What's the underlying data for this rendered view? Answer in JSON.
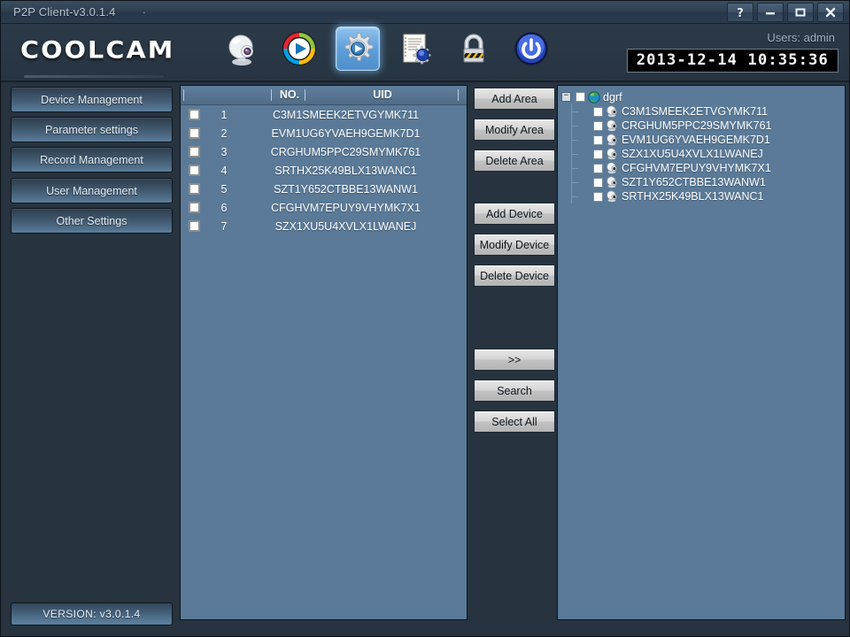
{
  "window": {
    "title": "P2P Client-v3.0.1.4",
    "buttons": [
      {
        "name": "help-button",
        "label": "?"
      },
      {
        "name": "minimize-button",
        "label": "–"
      },
      {
        "name": "maximize-button",
        "label": "□"
      },
      {
        "name": "close-button",
        "label": "✕"
      }
    ]
  },
  "header": {
    "logo": "COOLCAM",
    "user_label": "Users: admin",
    "datetime": "2013-12-14 10:35:36",
    "toolbar": [
      {
        "name": "camera-icon",
        "label": "Camera",
        "active": false
      },
      {
        "name": "playback-icon",
        "label": "Playback",
        "active": false
      },
      {
        "name": "settings-gear-icon",
        "label": "Settings",
        "active": true
      },
      {
        "name": "log-icon",
        "label": "Log",
        "active": false
      },
      {
        "name": "lock-icon",
        "label": "Lock",
        "active": false
      },
      {
        "name": "power-icon",
        "label": "Power",
        "active": false
      }
    ]
  },
  "sidebar": {
    "items": [
      {
        "label": "Device Management"
      },
      {
        "label": "Parameter settings"
      },
      {
        "label": "Record Management"
      },
      {
        "label": "User Management"
      },
      {
        "label": "Other Settings"
      }
    ],
    "version": "VERSION: v3.0.1.4"
  },
  "device_list": {
    "columns": [
      "NO.",
      "UID"
    ],
    "rows": [
      {
        "no": "1",
        "uid": "C3M1SMEEK2ETVGYMK711",
        "checked": false
      },
      {
        "no": "2",
        "uid": "EVM1UG6YVAEH9GEMK7D1",
        "checked": false
      },
      {
        "no": "3",
        "uid": "CRGHUM5PPC29SMYMK761",
        "checked": false
      },
      {
        "no": "4",
        "uid": "SRTHX25K49BLX13WANC1",
        "checked": false
      },
      {
        "no": "5",
        "uid": "SZT1Y652CTBBE13WANW1",
        "checked": false
      },
      {
        "no": "6",
        "uid": "CFGHVM7EPUY9VHYMK7X1",
        "checked": false
      },
      {
        "no": "7",
        "uid": "SZX1XU5U4XVLX1LWANEJ",
        "checked": false
      }
    ]
  },
  "actions": {
    "area": [
      {
        "label": "Add Area"
      },
      {
        "label": "Modify Area"
      },
      {
        "label": "Delete Area"
      }
    ],
    "device": [
      {
        "label": "Add Device"
      },
      {
        "label": "Modify Device"
      },
      {
        "label": "Delete Device"
      }
    ],
    "bottom": [
      {
        "label": ">>"
      },
      {
        "label": "Search"
      },
      {
        "label": "Select All"
      }
    ]
  },
  "tree": {
    "root": {
      "label": "dgrf",
      "expander": "−",
      "checked": false
    },
    "children": [
      {
        "label": "C3M1SMEEK2ETVGYMK711",
        "checked": false
      },
      {
        "label": "CRGHUM5PPC29SMYMK761",
        "checked": false
      },
      {
        "label": "EVM1UG6YVAEH9GEMK7D1",
        "checked": false
      },
      {
        "label": "SZX1XU5U4XVLX1LWANEJ",
        "checked": false
      },
      {
        "label": "CFGHVM7EPUY9VHYMK7X1",
        "checked": false
      },
      {
        "label": "SZT1Y652CTBBE13WANW1",
        "checked": false
      },
      {
        "label": "SRTHX25K49BLX13WANC1",
        "checked": false
      }
    ]
  },
  "colors": {
    "app_background": "#27333f",
    "panel_background": "#5a7a98",
    "accent": "#5e9fd8",
    "clock_background": "#000000"
  }
}
